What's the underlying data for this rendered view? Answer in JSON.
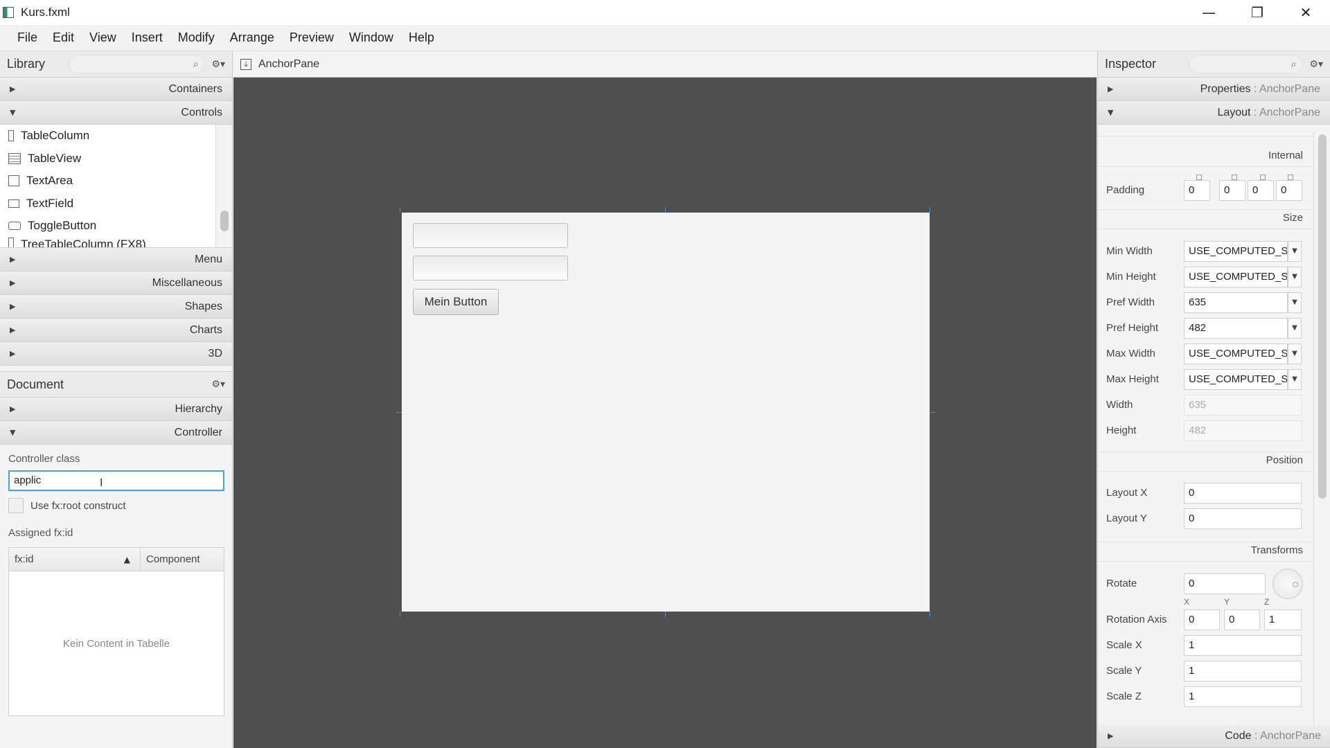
{
  "window": {
    "title": "Kurs.fxml",
    "minimize_glyph": "—",
    "restore_glyph": "❐",
    "close_glyph": "✕"
  },
  "menubar": {
    "items": [
      "File",
      "Edit",
      "View",
      "Insert",
      "Modify",
      "Arrange",
      "Preview",
      "Window",
      "Help"
    ]
  },
  "library": {
    "title": "Library",
    "sections_top": [
      {
        "label": "Containers",
        "expanded": false
      },
      {
        "label": "Controls",
        "expanded": true
      }
    ],
    "controls_items": [
      "TableColumn",
      "TableView",
      "TextArea",
      "TextField",
      "ToggleButton",
      "TreeTableColumn  (FX8)"
    ],
    "sections_bottom": [
      {
        "label": "Menu"
      },
      {
        "label": "Miscellaneous"
      },
      {
        "label": "Shapes"
      },
      {
        "label": "Charts"
      },
      {
        "label": "3D"
      }
    ]
  },
  "document": {
    "title": "Document",
    "sections": [
      {
        "label": "Hierarchy",
        "expanded": false
      },
      {
        "label": "Controller",
        "expanded": true
      }
    ],
    "controller_class_label": "Controller class",
    "controller_class_value": "applic",
    "fxroot_label": "Use fx:root construct",
    "assigned_label": "Assigned fx:id",
    "table_headers": [
      "fx:id",
      "Component"
    ],
    "table_empty": "Kein Content in Tabelle"
  },
  "center": {
    "selection": "AnchorPane",
    "button_label": "Mein Button"
  },
  "inspector": {
    "title": "Inspector",
    "sections": [
      {
        "label": "Properties",
        "target": "AnchorPane",
        "expanded": false
      },
      {
        "label": "Layout",
        "target": "AnchorPane",
        "expanded": true
      }
    ],
    "internal_title": "Internal",
    "padding_label": "Padding",
    "padding_values": [
      "0",
      "0",
      "0",
      "0"
    ],
    "size_title": "Size",
    "size_rows": [
      {
        "label": "Min Width",
        "value": "USE_COMPUTED_SIZE"
      },
      {
        "label": "Min Height",
        "value": "USE_COMPUTED_SIZE"
      },
      {
        "label": "Pref Width",
        "value": "635"
      },
      {
        "label": "Pref Height",
        "value": "482"
      },
      {
        "label": "Max Width",
        "value": "USE_COMPUTED_SIZE"
      },
      {
        "label": "Max Height",
        "value": "USE_COMPUTED_SIZE"
      }
    ],
    "width_label": "Width",
    "width_value": "635",
    "height_label": "Height",
    "height_value": "482",
    "position_title": "Position",
    "layout_x_label": "Layout X",
    "layout_x_value": "0",
    "layout_y_label": "Layout Y",
    "layout_y_value": "0",
    "transforms_title": "Transforms",
    "rotate_label": "Rotate",
    "rotate_value": "0",
    "axis_labels": [
      "X",
      "Y",
      "Z"
    ],
    "rotation_axis_label": "Rotation Axis",
    "rotation_axis_values": [
      "0",
      "0",
      "1"
    ],
    "scale_x_label": "Scale X",
    "scale_x_value": "1",
    "scale_y_label": "Scale Y",
    "scale_y_value": "1",
    "scale_z_label": "Scale Z",
    "scale_z_value": "1",
    "code_section": {
      "label": "Code",
      "target": "AnchorPane"
    }
  },
  "colors": {
    "canvas_bg": "#4f4f4f",
    "focus": "#3fa8d8",
    "guide": "#4a90d9"
  }
}
